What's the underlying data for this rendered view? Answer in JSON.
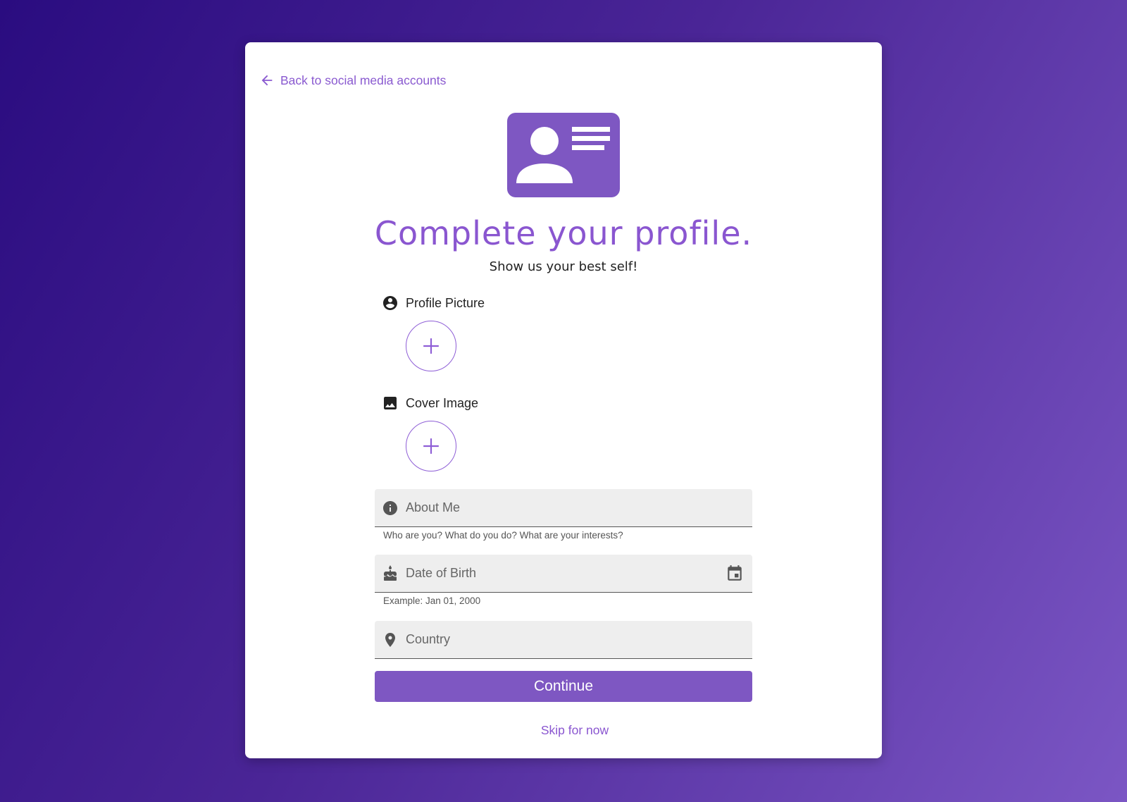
{
  "back_link": {
    "label": "Back to social media accounts",
    "icon": "arrow-left-icon"
  },
  "hero": {
    "icon": "contact-card-icon"
  },
  "header": {
    "title": "Complete your profile.",
    "subtitle": "Show us your best self!"
  },
  "uploads": {
    "profile_picture": {
      "label": "Profile Picture",
      "icon": "account-circle-icon",
      "button_icon": "plus-icon"
    },
    "cover_image": {
      "label": "Cover Image",
      "icon": "image-icon",
      "button_icon": "plus-icon"
    }
  },
  "fields": {
    "about_me": {
      "placeholder": "About Me",
      "value": "",
      "hint": "Who are you? What do you do? What are your interests?",
      "icon": "info-icon"
    },
    "date_of_birth": {
      "placeholder": "Date of Birth",
      "value": "",
      "hint": "Example: Jan 01, 2000",
      "icon": "cake-icon",
      "trailing_icon": "calendar-icon"
    },
    "country": {
      "placeholder": "Country",
      "value": "",
      "icon": "location-pin-icon"
    }
  },
  "actions": {
    "continue_label": "Continue",
    "skip_label": "Skip for now"
  },
  "colors": {
    "accent": "#7e57c2",
    "link": "#8a56d0",
    "field_bg": "#eeeeee"
  }
}
